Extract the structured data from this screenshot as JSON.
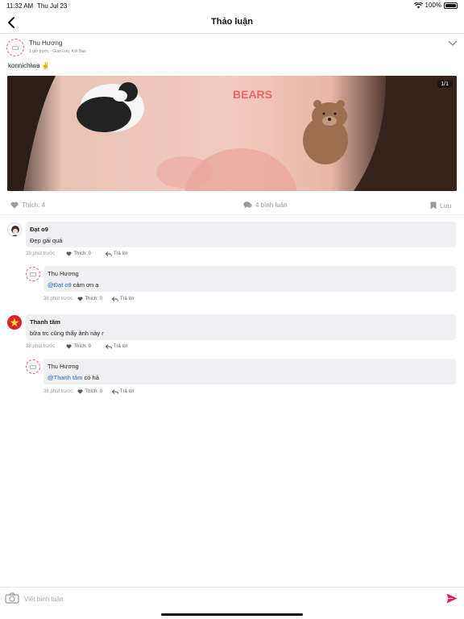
{
  "status_bar": {
    "time": "11:32 AM",
    "date": "Thu Jul 23",
    "battery": "100%"
  },
  "nav": {
    "title": "Thảo luận",
    "back_icon": "chevron-left-icon"
  },
  "post": {
    "author": "Thu Hương",
    "meta": "1 giờ trước - Giao Lưu, Kết Bạn",
    "text": "konnichiwa ✌️",
    "image_counter": "1/1",
    "image_text": "BEARS",
    "like_label": "Thích: 4",
    "comment_label": "4 bình luận",
    "save_label": "Lưu"
  },
  "comments": [
    {
      "name": "Đạt o9",
      "text": "Đẹp gái quá",
      "time": "39 phút trước",
      "like": "Thích: 0",
      "reply": "Trả lời",
      "replies": [
        {
          "name": "Thu Hương",
          "mention": "@Đạt o9",
          "text": " cảm ơn ạ",
          "time": "36 phút trước",
          "like": "Thích: 0",
          "reply": "Trả lời"
        }
      ]
    },
    {
      "name": "Thanh tâm",
      "text": "bữa trc cũng thấy ảnh này r",
      "time": "38 phút trước",
      "like": "Thích: 0",
      "reply": "Trả lời",
      "replies": [
        {
          "name": "Thu Hương",
          "mention": "@Thanh tâm",
          "text": " có hả",
          "time": "36 phút trước",
          "like": "Thích: 0",
          "reply": "Trả lời"
        }
      ]
    }
  ],
  "input": {
    "placeholder": "Viết bình luận"
  },
  "colors": {
    "accent": "#e8175d",
    "mention": "#2a5fd6",
    "bubble": "#f0f0f2"
  }
}
